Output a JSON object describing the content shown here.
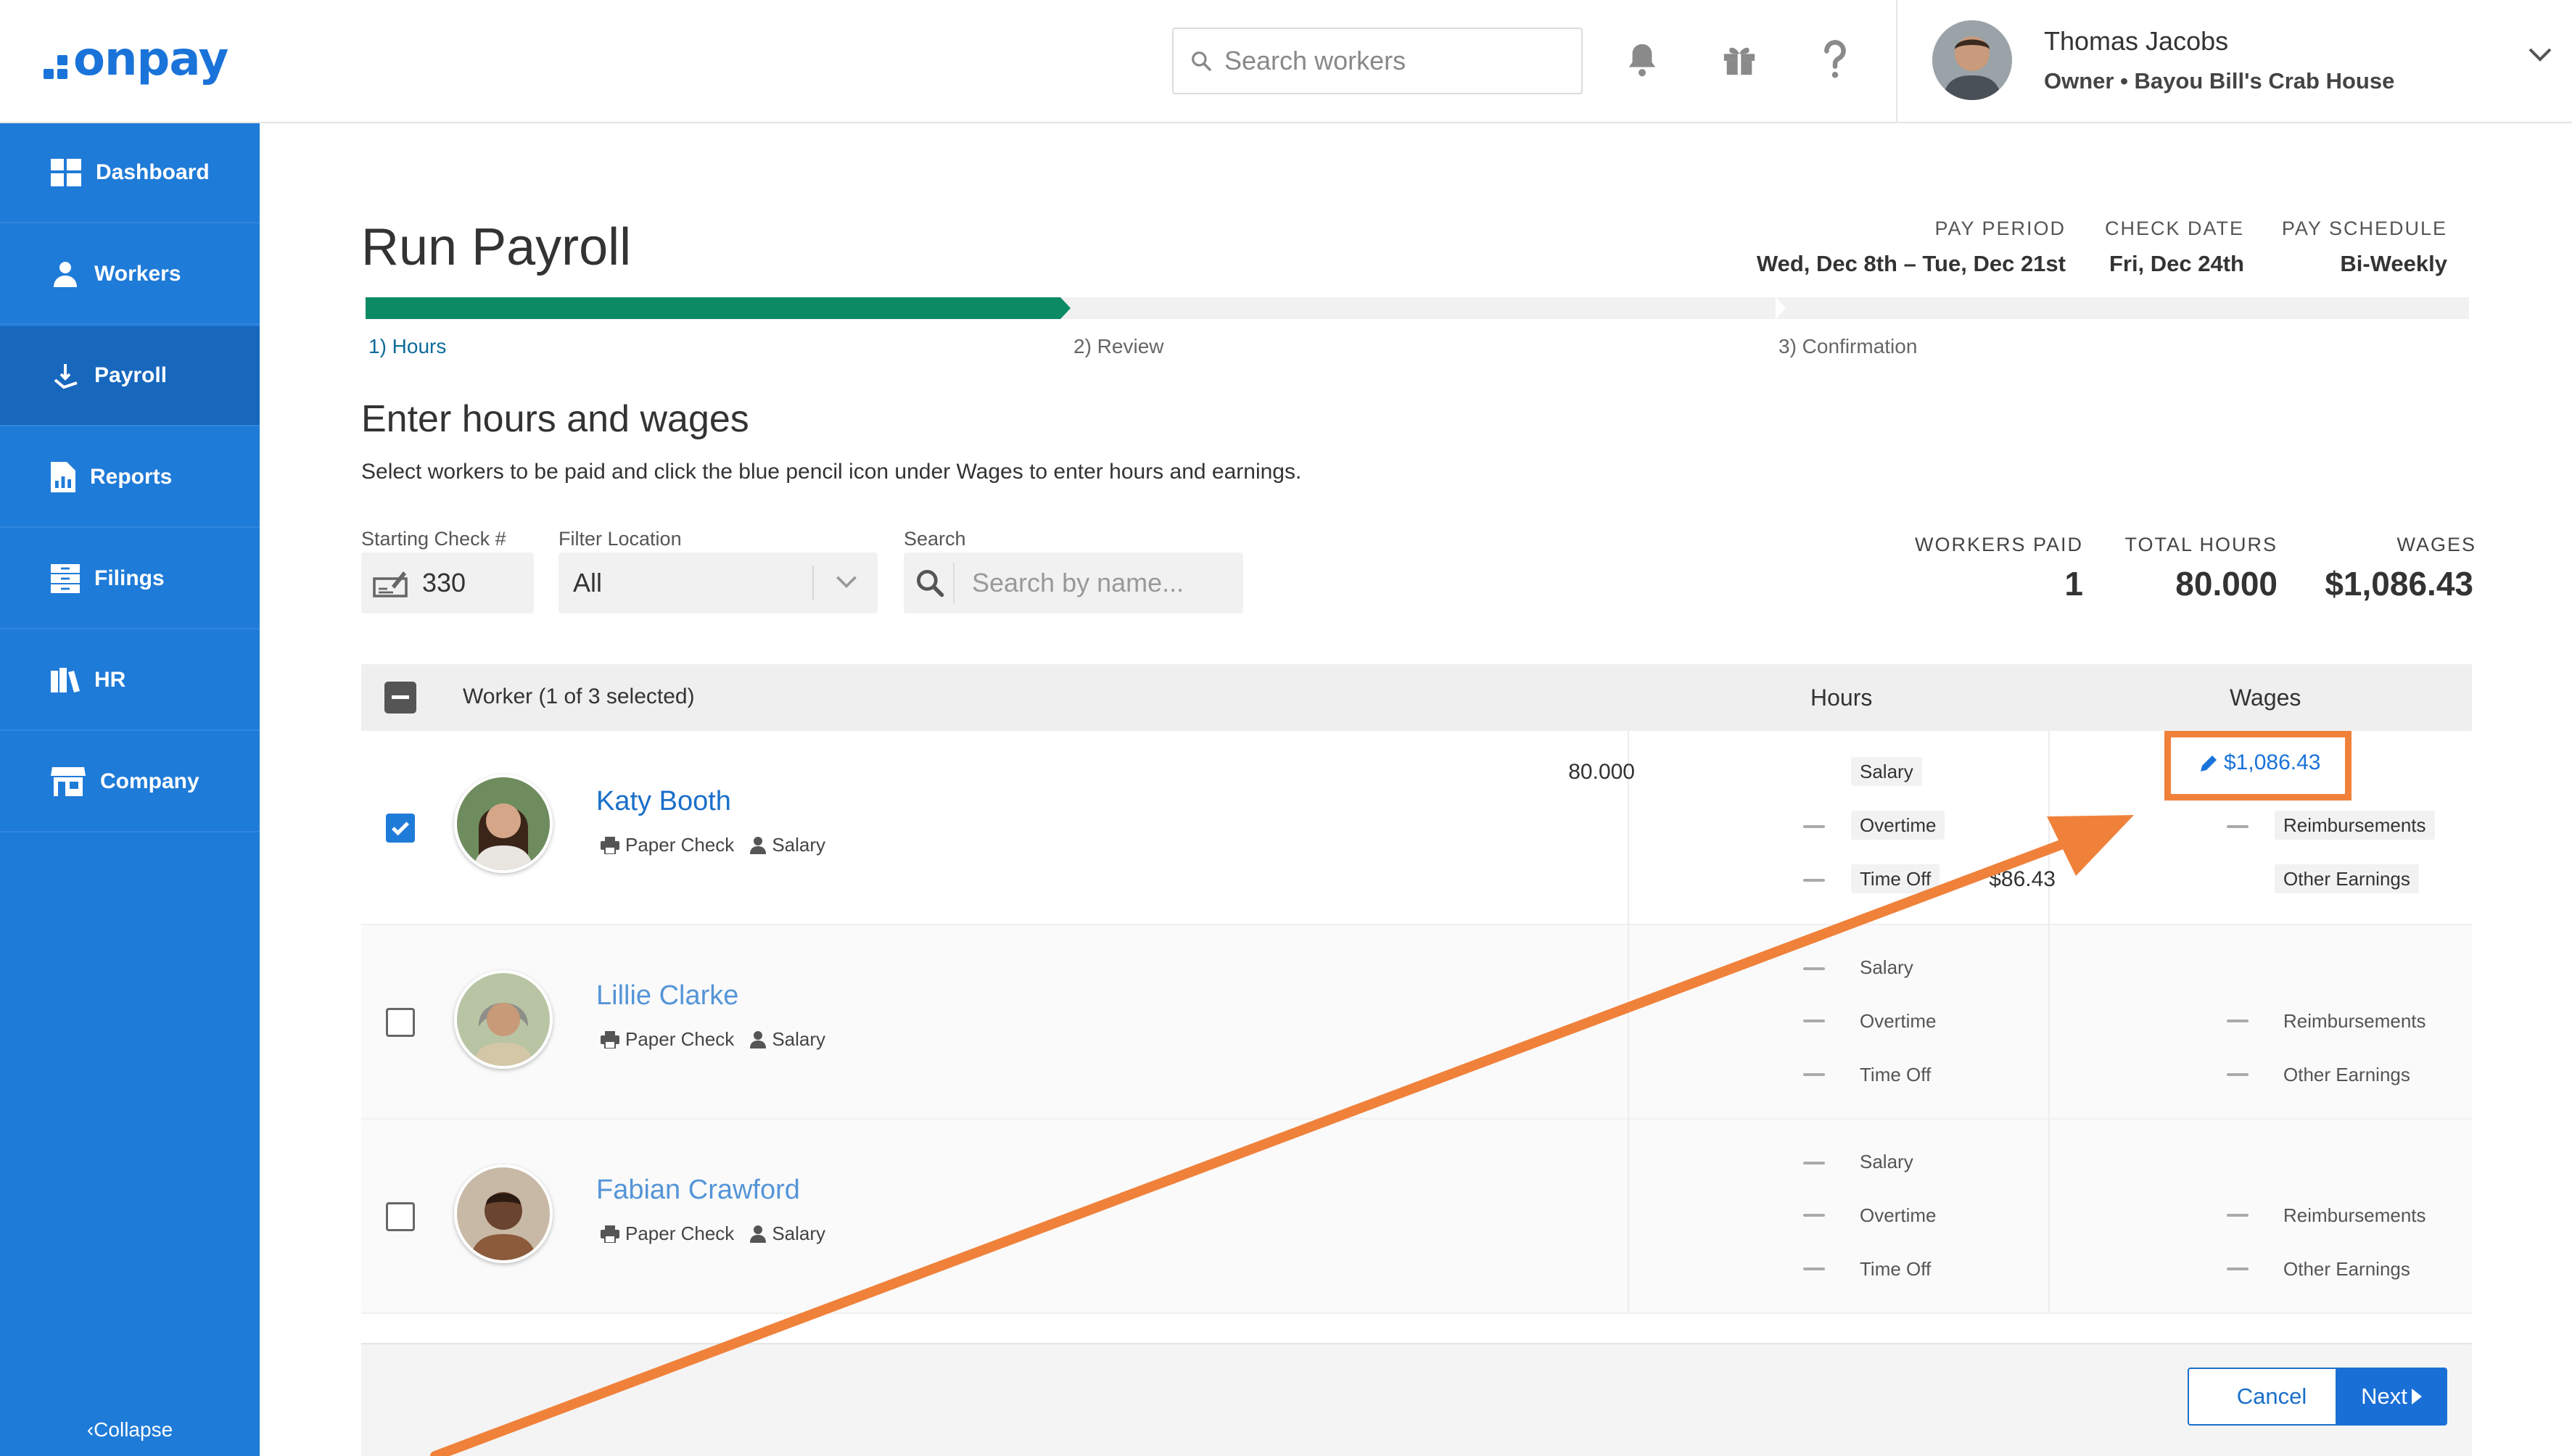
{
  "header": {
    "logo_text": "onpay",
    "logo_dot": ".",
    "search_placeholder": "Search workers",
    "user_name": "Thomas Jacobs",
    "user_role": "Owner • Bayou Bill's Crab House"
  },
  "sidebar": {
    "items": [
      {
        "label": "Dashboard",
        "icon": "dashboard-icon"
      },
      {
        "label": "Workers",
        "icon": "workers-icon"
      },
      {
        "label": "Payroll",
        "icon": "payroll-icon",
        "active": true
      },
      {
        "label": "Reports",
        "icon": "reports-icon"
      },
      {
        "label": "Filings",
        "icon": "filings-icon"
      },
      {
        "label": "HR",
        "icon": "hr-icon"
      },
      {
        "label": "Company",
        "icon": "company-icon"
      }
    ],
    "collapse_label": "‹Collapse"
  },
  "page": {
    "title": "Run Payroll",
    "pay_period_label": "PAY PERIOD",
    "pay_period_value": "Wed, Dec 8th – Tue, Dec 21st",
    "check_date_label": "CHECK DATE",
    "check_date_value": "Fri, Dec 24th",
    "pay_schedule_label": "PAY SCHEDULE",
    "pay_schedule_value": "Bi-Weekly",
    "steps": [
      "1) Hours",
      "2) Review",
      "3) Confirmation"
    ],
    "section_title": "Enter hours and wages",
    "section_desc": "Select workers to be paid and click the blue pencil icon under Wages to enter hours and earnings."
  },
  "filters": {
    "starting_check_label": "Starting Check #",
    "starting_check_value": "330",
    "filter_location_label": "Filter Location",
    "filter_location_value": "All",
    "search_label": "Search",
    "search_placeholder": "Search by name..."
  },
  "summary": {
    "workers_paid_label": "WORKERS PAID",
    "workers_paid_value": "1",
    "total_hours_label": "TOTAL HOURS",
    "total_hours_value": "80.000",
    "wages_label": "WAGES",
    "wages_value": "$1,086.43"
  },
  "table": {
    "worker_header": "Worker (1 of 3 selected)",
    "hours_header": "Hours",
    "wages_header": "Wages",
    "rows": [
      {
        "name": "Katy Booth",
        "pay_method": "Paper Check",
        "pay_type": "Salary",
        "checked": true,
        "salary_hours": "80.000",
        "hours_labels": [
          "Salary",
          "Overtime",
          "Time Off"
        ],
        "wage_link": "$1,086.43",
        "other_earnings": "$86.43",
        "wage_labels": [
          "Reimbursements",
          "Other Earnings"
        ]
      },
      {
        "name": "Lillie Clarke",
        "pay_method": "Paper Check",
        "pay_type": "Salary",
        "checked": false,
        "hours_labels": [
          "Salary",
          "Overtime",
          "Time Off"
        ],
        "wage_labels": [
          "Reimbursements",
          "Other Earnings"
        ]
      },
      {
        "name": "Fabian Crawford",
        "pay_method": "Paper Check",
        "pay_type": "Salary",
        "checked": false,
        "hours_labels": [
          "Salary",
          "Overtime",
          "Time Off"
        ],
        "wage_labels": [
          "Reimbursements",
          "Other Earnings"
        ]
      }
    ]
  },
  "footer": {
    "cancel_label": "Cancel",
    "next_label": "Next"
  },
  "colors": {
    "brand_blue": "#1f7bd8",
    "progress_green": "#0c8a64",
    "annotation_orange": "#f0813a"
  }
}
